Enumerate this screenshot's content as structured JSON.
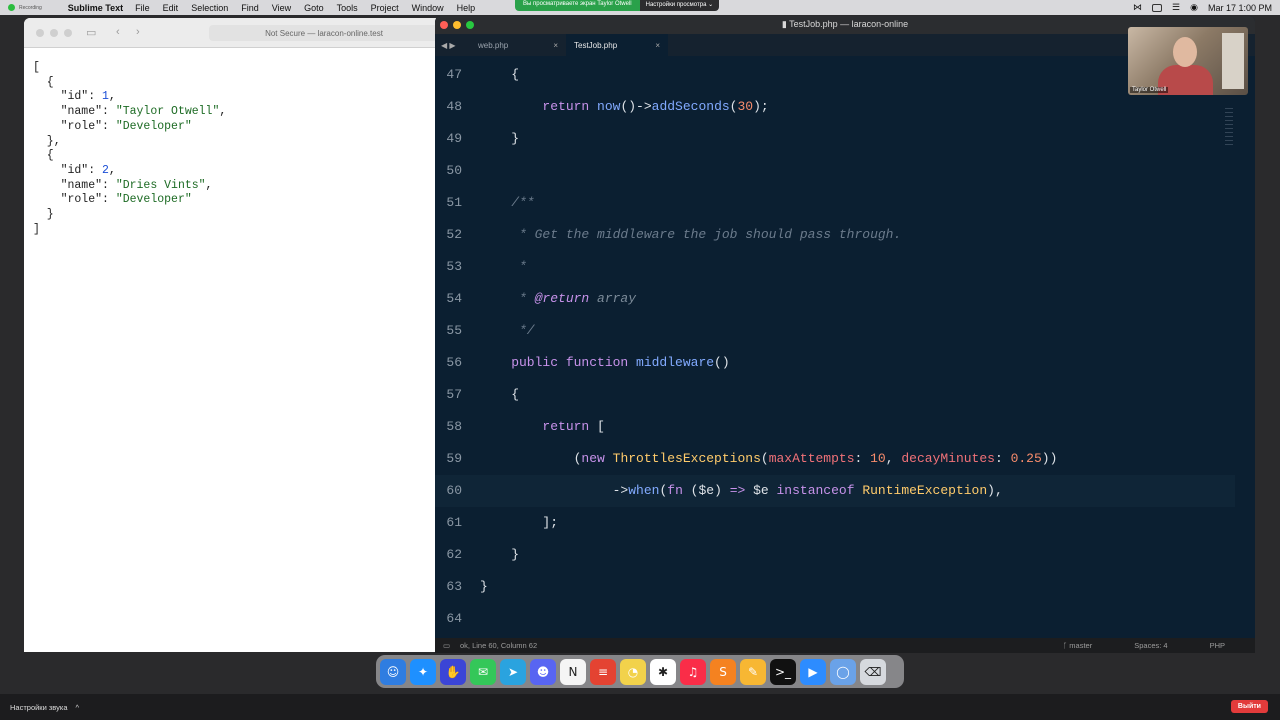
{
  "menubar": {
    "recording_label": "Recording",
    "app_name": "Sublime Text",
    "items": [
      "File",
      "Edit",
      "Selection",
      "Find",
      "View",
      "Goto",
      "Tools",
      "Project",
      "Window",
      "Help"
    ],
    "clock": "Mar 17  1:00 PM"
  },
  "share_banner": {
    "viewing_text": "Вы просматриваете экран Taylor Otwell",
    "settings_label": "Настройки просмотра ⌄"
  },
  "browser": {
    "url_text": "Not Secure — laracon-online.test",
    "json_lines": [
      [
        {
          "t": "["
        }
      ],
      [
        {
          "t": "  {"
        }
      ],
      [
        {
          "t": "    \"id\": "
        },
        {
          "t": "1",
          "c": "num"
        },
        {
          "t": ","
        }
      ],
      [
        {
          "t": "    \"name\": "
        },
        {
          "t": "\"Taylor Otwell\"",
          "c": "str"
        },
        {
          "t": ","
        }
      ],
      [
        {
          "t": "    \"role\": "
        },
        {
          "t": "\"Developer\"",
          "c": "str"
        }
      ],
      [
        {
          "t": "  },"
        }
      ],
      [
        {
          "t": "  {"
        }
      ],
      [
        {
          "t": "    \"id\": "
        },
        {
          "t": "2",
          "c": "num"
        },
        {
          "t": ","
        }
      ],
      [
        {
          "t": "    \"name\": "
        },
        {
          "t": "\"Dries Vints\"",
          "c": "str"
        },
        {
          "t": ","
        }
      ],
      [
        {
          "t": "    \"role\": "
        },
        {
          "t": "\"Developer\"",
          "c": "str"
        }
      ],
      [
        {
          "t": "  }"
        }
      ],
      [
        {
          "t": "]"
        }
      ]
    ]
  },
  "editor": {
    "window_title": "TestJob.php — laracon-online",
    "tabs": [
      {
        "label": "web.php",
        "active": false
      },
      {
        "label": "TestJob.php",
        "active": true
      }
    ],
    "current_line": 60,
    "lines": [
      {
        "n": 47,
        "tokens": [
          {
            "t": "    {",
            "c": "pn"
          }
        ]
      },
      {
        "n": 48,
        "tokens": [
          {
            "t": "        return ",
            "c": "kw"
          },
          {
            "t": "now",
            "c": "fn"
          },
          {
            "t": "()->",
            "c": "pn"
          },
          {
            "t": "addSeconds",
            "c": "fn"
          },
          {
            "t": "(",
            "c": "pn"
          },
          {
            "t": "30",
            "c": "num"
          },
          {
            "t": ");",
            "c": "pn"
          }
        ]
      },
      {
        "n": 49,
        "tokens": [
          {
            "t": "    }",
            "c": "pn"
          }
        ]
      },
      {
        "n": 50,
        "tokens": []
      },
      {
        "n": 51,
        "tokens": [
          {
            "t": "    /**",
            "c": "cm"
          }
        ]
      },
      {
        "n": 52,
        "tokens": [
          {
            "t": "     * Get the middleware the job should pass through.",
            "c": "cm"
          }
        ]
      },
      {
        "n": 53,
        "tokens": [
          {
            "t": "     *",
            "c": "cm"
          }
        ]
      },
      {
        "n": 54,
        "tokens": [
          {
            "t": "     * ",
            "c": "cm"
          },
          {
            "t": "@return",
            "c": "tag"
          },
          {
            "t": " array",
            "c": "ty"
          }
        ]
      },
      {
        "n": 55,
        "tokens": [
          {
            "t": "     */",
            "c": "cm"
          }
        ]
      },
      {
        "n": 56,
        "tokens": [
          {
            "t": "    public function ",
            "c": "kw"
          },
          {
            "t": "middleware",
            "c": "fn"
          },
          {
            "t": "()",
            "c": "pn"
          }
        ]
      },
      {
        "n": 57,
        "tokens": [
          {
            "t": "    {",
            "c": "pn"
          }
        ]
      },
      {
        "n": 58,
        "tokens": [
          {
            "t": "        return ",
            "c": "kw"
          },
          {
            "t": "[",
            "c": "pn"
          }
        ]
      },
      {
        "n": 59,
        "tokens": [
          {
            "t": "            (",
            "c": "pn"
          },
          {
            "t": "new ",
            "c": "kw"
          },
          {
            "t": "ThrottlesExceptions",
            "c": "cls"
          },
          {
            "t": "(",
            "c": "pn"
          },
          {
            "t": "maxAttempts",
            "c": "nm"
          },
          {
            "t": ": ",
            "c": "pn"
          },
          {
            "t": "10",
            "c": "num"
          },
          {
            "t": ", ",
            "c": "pn"
          },
          {
            "t": "decayMinutes",
            "c": "nm"
          },
          {
            "t": ": ",
            "c": "pn"
          },
          {
            "t": "0.25",
            "c": "num"
          },
          {
            "t": "))",
            "c": "pn"
          }
        ]
      },
      {
        "n": 60,
        "tokens": [
          {
            "t": "                 ->",
            "c": "pn"
          },
          {
            "t": "when",
            "c": "fn"
          },
          {
            "t": "(",
            "c": "pn"
          },
          {
            "t": "fn ",
            "c": "kw"
          },
          {
            "t": "($e) ",
            "c": "pn"
          },
          {
            "t": "=> ",
            "c": "kw"
          },
          {
            "t": "$e ",
            "c": "pn"
          },
          {
            "t": "instanceof ",
            "c": "kw"
          },
          {
            "t": "RuntimeException",
            "c": "cls"
          },
          {
            "t": "),",
            "c": "pn"
          }
        ]
      },
      {
        "n": 61,
        "tokens": [
          {
            "t": "        ];",
            "c": "pn"
          }
        ]
      },
      {
        "n": 62,
        "tokens": [
          {
            "t": "    }",
            "c": "pn"
          }
        ]
      },
      {
        "n": 63,
        "tokens": [
          {
            "t": "}",
            "c": "pn"
          }
        ]
      },
      {
        "n": 64,
        "tokens": []
      }
    ],
    "status_left": "ok, Line 60, Column 62",
    "status_branch": "master",
    "status_spaces": "Spaces: 4",
    "status_syntax": "PHP"
  },
  "webcam": {
    "participant_name": "Taylor Otwell"
  },
  "dock": {
    "apps": [
      {
        "name": "finder",
        "color": "#2f7de1",
        "glyph": "☺"
      },
      {
        "name": "safari",
        "color": "#1e90ff",
        "glyph": "✦"
      },
      {
        "name": "raycast",
        "color": "#3b45d6",
        "glyph": "✋"
      },
      {
        "name": "messages",
        "color": "#34c759",
        "glyph": "✉"
      },
      {
        "name": "telegram",
        "color": "#2aa3df",
        "glyph": "➤"
      },
      {
        "name": "discord",
        "color": "#5865f2",
        "glyph": "☻"
      },
      {
        "name": "notion",
        "color": "#f5f5f5",
        "glyph": "N"
      },
      {
        "name": "todoist",
        "color": "#e44332",
        "glyph": "≡"
      },
      {
        "name": "clock",
        "color": "#f2d24b",
        "glyph": "◔"
      },
      {
        "name": "slack",
        "color": "#ffffff",
        "glyph": "✱"
      },
      {
        "name": "music",
        "color": "#fa2d48",
        "glyph": "♫"
      },
      {
        "name": "sublime-text",
        "color": "#f58220",
        "glyph": "S"
      },
      {
        "name": "tableplus",
        "color": "#f7b733",
        "glyph": "✎"
      },
      {
        "name": "terminal",
        "color": "#111111",
        "glyph": ">_"
      },
      {
        "name": "zoom",
        "color": "#2d8cff",
        "glyph": "▶"
      },
      {
        "name": "database",
        "color": "#6aa2e8",
        "glyph": "◯"
      },
      {
        "name": "trash",
        "color": "#d6d9de",
        "glyph": "⌫"
      }
    ]
  },
  "bottombar": {
    "sound_settings": "Настройки звука",
    "chevron": "^",
    "exit_label": "Выйти"
  }
}
